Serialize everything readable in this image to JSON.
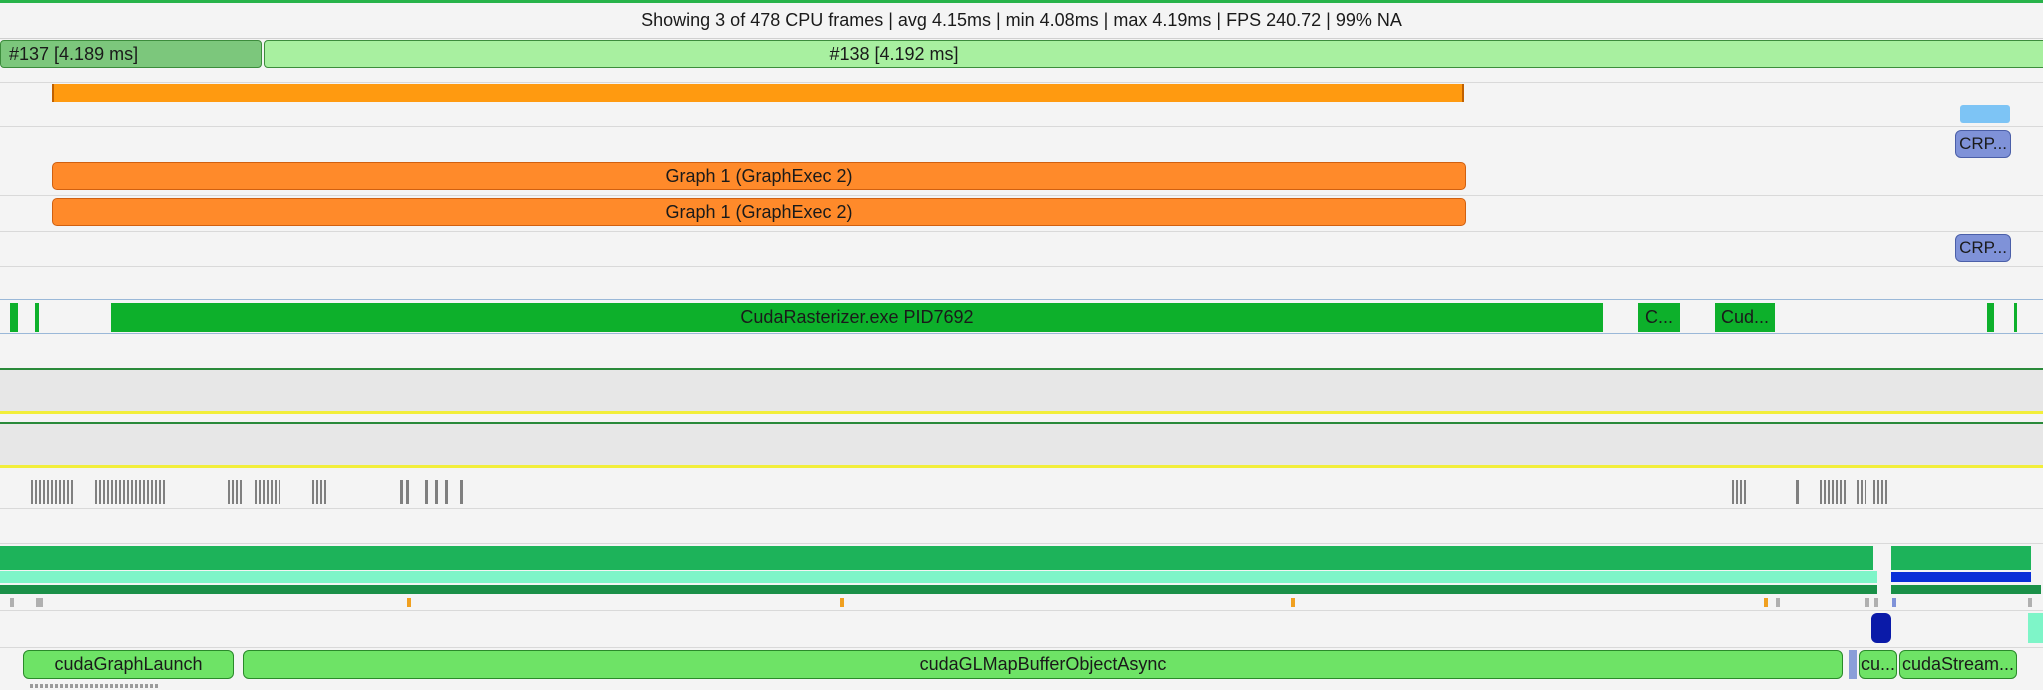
{
  "summary": {
    "text": "Showing 3 of 478 CPU frames | avg 4.15ms | min 4.08ms | max 4.19ms | FPS 240.72 | 99% NA"
  },
  "frames": [
    {
      "label": "#137 [4.189 ms]"
    },
    {
      "label": "#138 [4.192 ms]"
    }
  ],
  "graph_rows": [
    {
      "label": "Graph 1 (GraphExec 2)"
    },
    {
      "label": "Graph 1 (GraphExec 2)"
    }
  ],
  "crp_badges": [
    {
      "label": "CRP..."
    },
    {
      "label": "CRP..."
    }
  ],
  "process_row": {
    "main_label": "CudaRasterizer.exe PID7692",
    "short1": "C...",
    "short2": "Cud..."
  },
  "api_row": {
    "items": [
      {
        "label": "cudaGraphLaunch"
      },
      {
        "label": "cudaGLMapBufferObjectAsync"
      },
      {
        "label": "cu..."
      },
      {
        "label": "cudaStream..."
      }
    ]
  },
  "colors": {
    "frame_dark": "#7cc77c",
    "frame_light": "#a8f0a0",
    "orange": "#ff8a2a",
    "orange_thin": "#ff9a10",
    "crp_badge": "#7f92d8",
    "process_green": "#0db02b",
    "teal_bar": "#1db35a",
    "mint_bar": "#7ef5c8",
    "blue_bar": "#0a2fd8",
    "navy_chip": "#0a1aa8",
    "api_green": "#6ee366",
    "yellow_line": "#f2ee3a"
  }
}
